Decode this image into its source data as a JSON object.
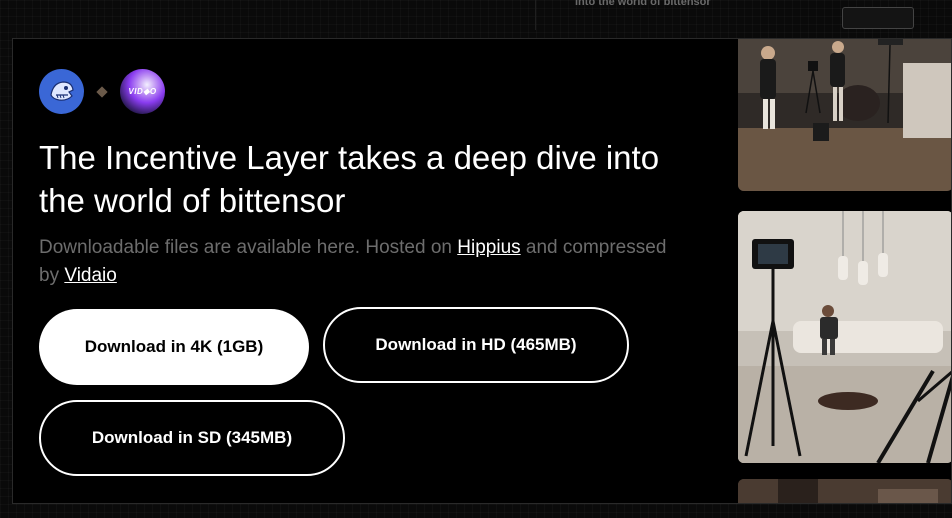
{
  "background": {
    "strip_text": "into the world of bittensor"
  },
  "logos": {
    "second_logo_text": "VID◆O"
  },
  "headline": "The Incentive Layer takes a deep dive into the world of bittensor",
  "description": {
    "prefix": "Downloadable files are available here. Hosted on ",
    "host_link": "Hippius",
    "middle": " and compressed by ",
    "compress_link": "Vidaio"
  },
  "buttons": {
    "download_4k": "Download in 4K (1GB)",
    "download_hd": "Download in HD (465MB)",
    "download_sd": "Download in SD (345MB)"
  },
  "colors": {
    "background": "#000000",
    "primary_button": "#ffffff",
    "muted_text": "#6d6d6d",
    "logo_blue": "#3a67d6"
  },
  "icons": {
    "logo_a": "mascot-logo-icon",
    "logo_b": "vidaio-logo-icon",
    "separator": "diamond-icon"
  }
}
